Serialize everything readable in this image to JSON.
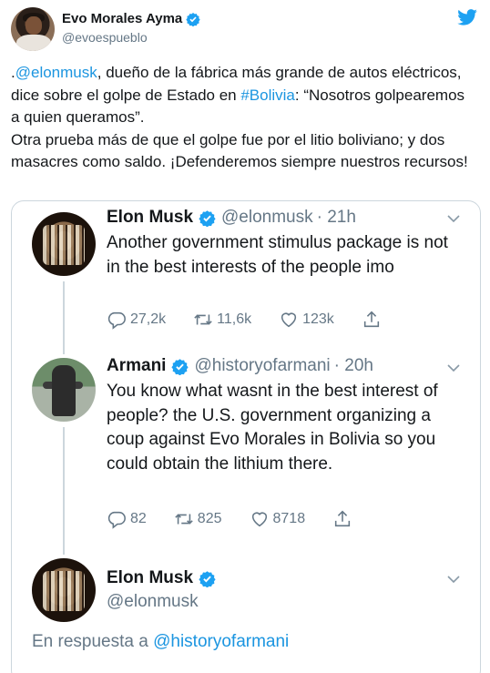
{
  "tweet": {
    "author": {
      "display_name": "Evo Morales Ayma",
      "handle": "@evoespueblo",
      "verified": true
    },
    "text": {
      "prefix": ".",
      "mention": "@elonmusk",
      "part1": ", dueño de la fábrica más grande de autos eléctricos, dice sobre el golpe de Estado en ",
      "hashtag": "#Bolivia",
      "part2": ": “Nosotros golpearemos a quien queramos”.",
      "part3": "Otra prueba más de que el golpe fue por el litio boliviano; y dos masacres como saldo. ¡Defenderemos siempre nuestros recursos!"
    }
  },
  "quoted_thread": [
    {
      "display_name": "Elon Musk",
      "handle": "@elonmusk",
      "time": "· 21h",
      "text": "Another government stimulus package is not in the best interests of the people imo",
      "replies": "27,2k",
      "retweets": "11,6k",
      "likes": "123k"
    },
    {
      "display_name": "Armani",
      "handle": "@historyofarmani",
      "time": "· 20h",
      "text": "You know what wasnt in the best interest of people? the U.S. government organizing a coup against Evo Morales in Bolivia so you could obtain the lithium there.",
      "replies": "82",
      "retweets": "825",
      "likes": "8718"
    },
    {
      "display_name": "Elon Musk",
      "handle": "@elonmusk",
      "reply_prefix": "En respuesta a ",
      "reply_to": "@historyofarmani"
    }
  ],
  "icons": {
    "verified": "verified-badge-icon",
    "brand": "twitter-bird-icon",
    "reply": "reply-icon",
    "retweet": "retweet-icon",
    "like": "heart-icon",
    "share": "share-icon",
    "more": "chevron-down-icon"
  },
  "colors": {
    "link": "#1b95e0",
    "verified": "#1da1f2",
    "secondary_text": "#657786",
    "border": "#ccd6dd"
  }
}
